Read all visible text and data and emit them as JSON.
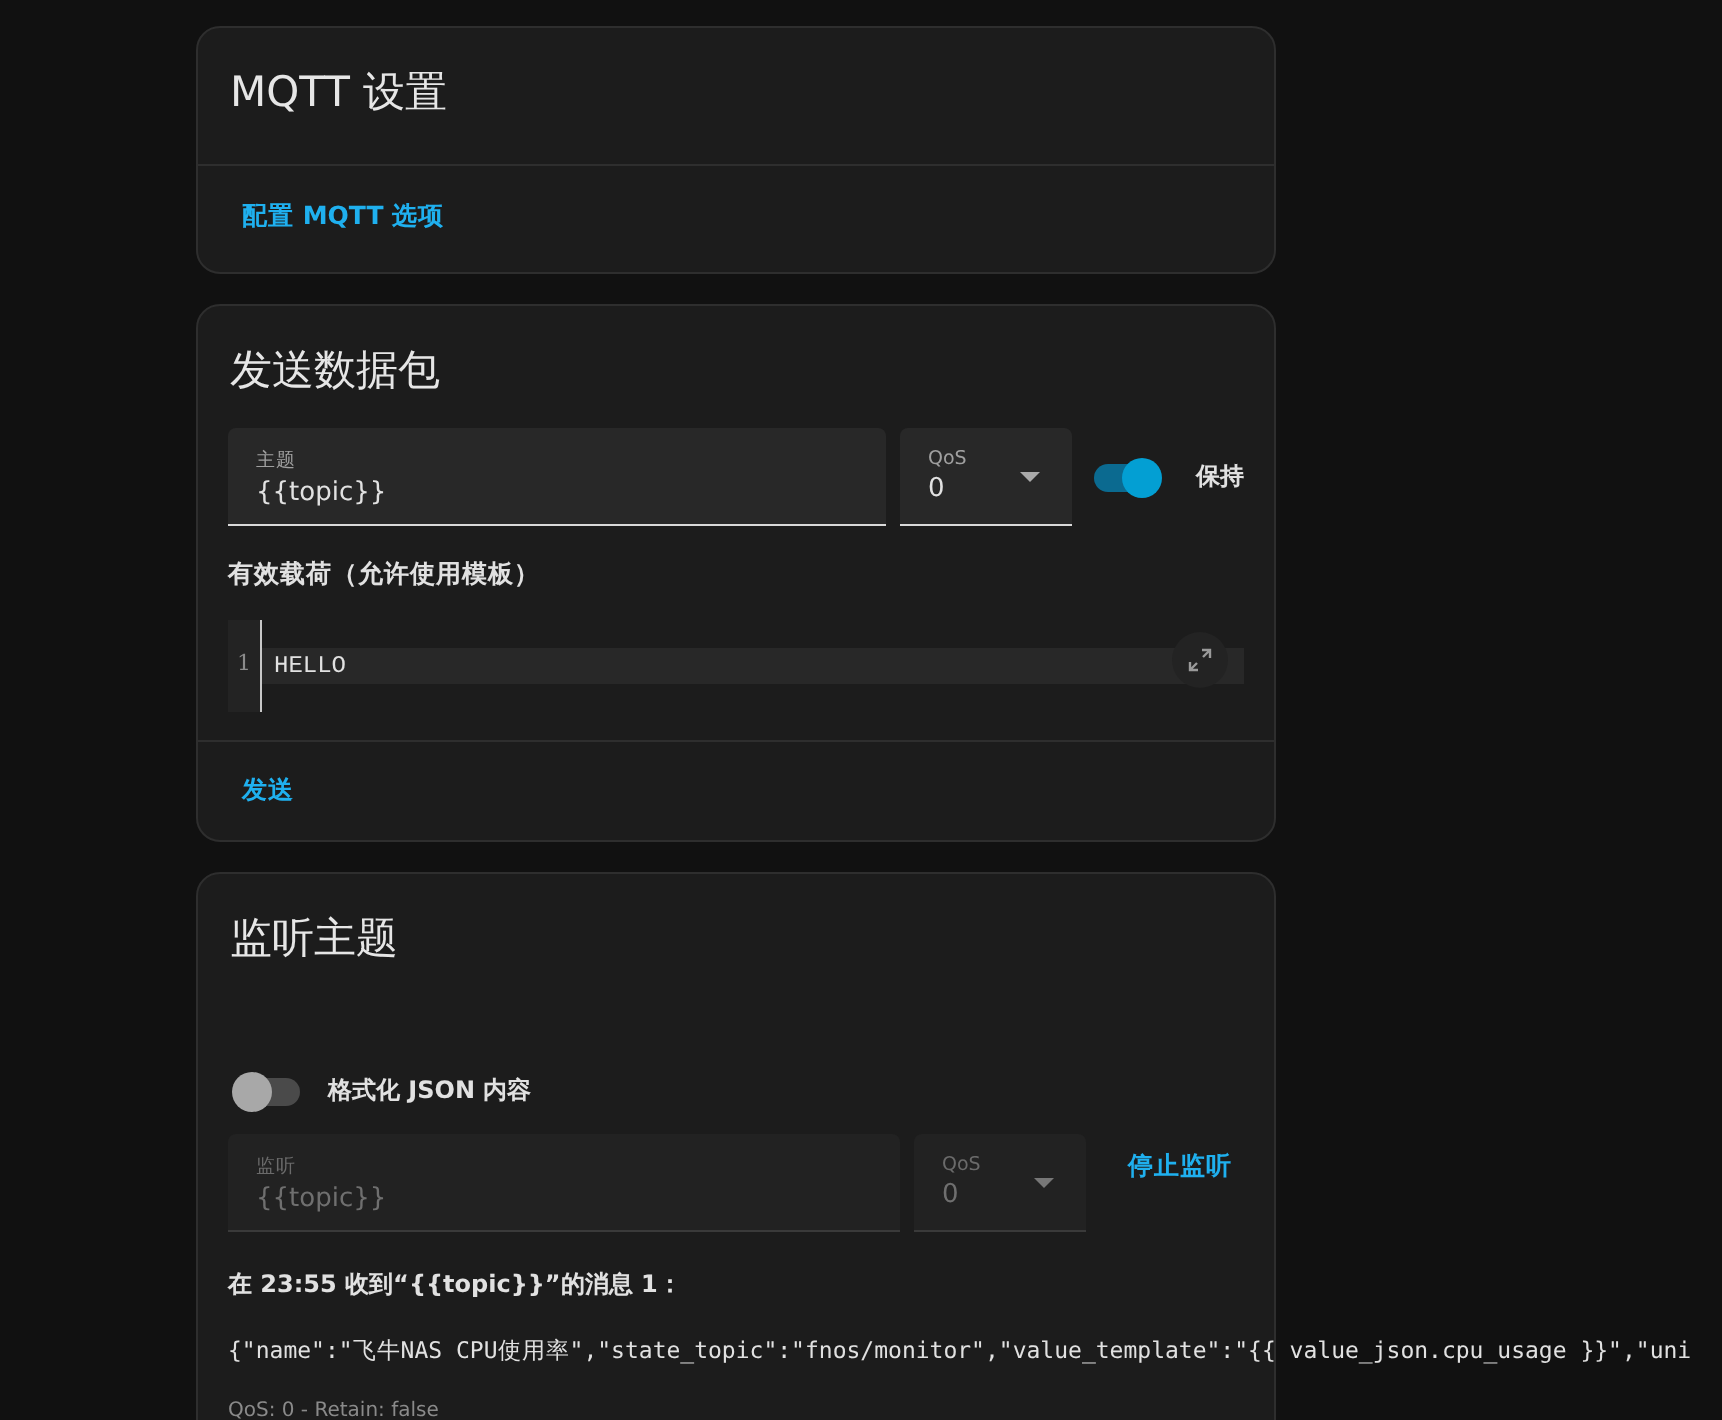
{
  "cards": [
    {
      "kind": "settings",
      "title": "MQTT 设置",
      "action": "配置 MQTT 选项"
    },
    {
      "kind": "publish",
      "title": "发送数据包",
      "topic_field": {
        "label": "主题",
        "value": "{{topic}}"
      },
      "qos_field": {
        "label": "QoS",
        "value": "0"
      },
      "retain": {
        "label": "保持",
        "on": true
      },
      "payload_label": "有效载荷（允许使用模板）",
      "editor": {
        "lines": [
          {
            "number": "1",
            "text": "HELLO"
          }
        ]
      },
      "action": "发送"
    },
    {
      "kind": "listen",
      "title": "监听主题",
      "format_json": {
        "label": "格式化 JSON 内容",
        "on": false
      },
      "topic_field": {
        "label": "监听",
        "value": "{{topic}}",
        "disabled": true
      },
      "qos_field": {
        "label": "QoS",
        "value": "0",
        "disabled": true
      },
      "action": "停止监听",
      "messages": [
        {
          "header": "在 23:55 收到“{{topic}}”的消息 1：",
          "body": "{\"name\":\"飞牛NAS CPU使用率\",\"state_topic\":\"fnos/monitor\",\"value_template\":\"{{ value_json.cpu_usage }}\",\"uni",
          "meta": "QoS: 0 - Retain: false"
        }
      ]
    }
  ]
}
